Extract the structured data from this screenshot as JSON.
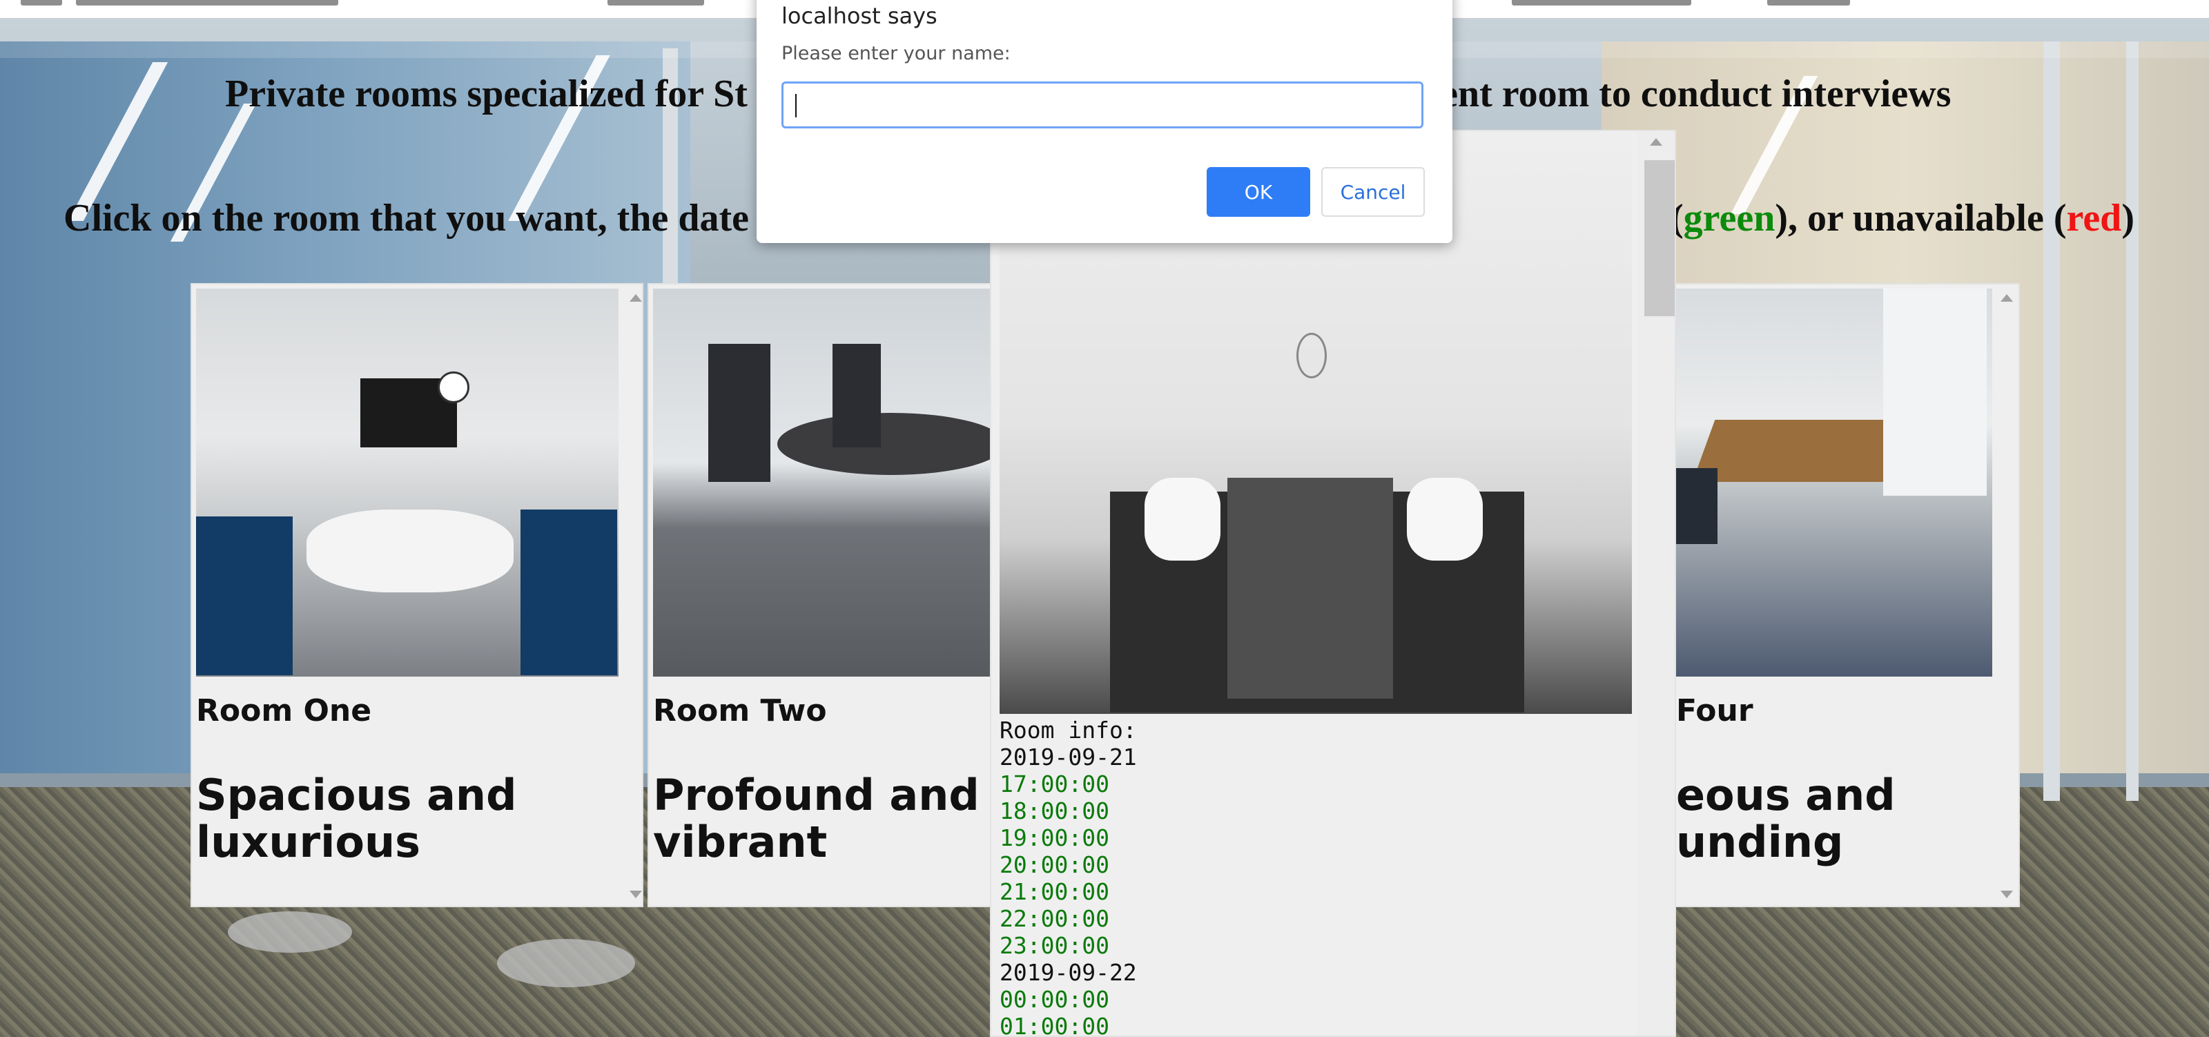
{
  "page": {
    "heading_left": "Private rooms specialized for St",
    "heading_right": "ilent room to conduct interviews",
    "instruction_left": "Click on the room that you want, the date",
    "instruction_right_paren_open": "(",
    "instruction_green": "green",
    "instruction_mid": "), or unavailable (",
    "instruction_red": "red",
    "instruction_close": ")"
  },
  "rooms": [
    {
      "name": "Room One",
      "desc_line1": "Spacious and",
      "desc_line2": "luxurious"
    },
    {
      "name": "Room Two",
      "desc_line1": "Profound and",
      "desc_line2": "vibrant"
    },
    {
      "name": "Four",
      "desc_line1": "eous and",
      "desc_line2": "unding"
    }
  ],
  "room_three": {
    "info_label": "Room info:",
    "schedule": [
      {
        "date": "2019-09-21",
        "times": [
          "17:00:00",
          "18:00:00",
          "19:00:00",
          "20:00:00",
          "21:00:00",
          "22:00:00",
          "23:00:00"
        ]
      },
      {
        "date": "2019-09-22",
        "times": [
          "00:00:00",
          "01:00:00"
        ]
      }
    ]
  },
  "dialog": {
    "title": "localhost says",
    "prompt": "Please enter your name:",
    "input_value": "",
    "ok_label": "OK",
    "cancel_label": "Cancel"
  },
  "colors": {
    "available": "#0b8a0b",
    "unavailable": "#f01414",
    "ok_button": "#2f7df6"
  }
}
